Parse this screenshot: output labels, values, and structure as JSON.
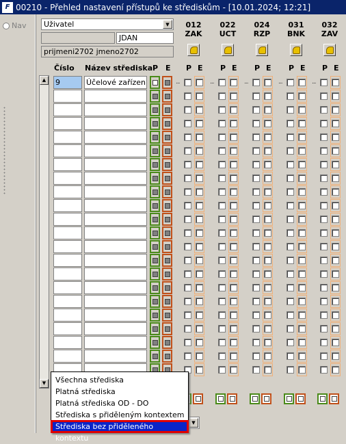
{
  "window": {
    "title": "00210 - Přehled nastavení přístupů ke střediskům - [10.01.2024; 12:21]",
    "logo": "F"
  },
  "nav": {
    "label": "Nav"
  },
  "selector": {
    "value": "Uživatel",
    "user_code": "JDAN",
    "full_name": "prijmeni2702 jmeno2702"
  },
  "columns": {
    "cislo": "Číslo",
    "nazev": "Název střediska",
    "p": "P",
    "e": "E"
  },
  "modules": [
    {
      "num": "012",
      "code": "ZAK"
    },
    {
      "num": "022",
      "code": "UCT"
    },
    {
      "num": "024",
      "code": "RZP"
    },
    {
      "num": "031",
      "code": "BNK"
    },
    {
      "num": "032",
      "code": "ZAV"
    }
  ],
  "rows": [
    {
      "cislo": "9",
      "nazev": "Účelové zařízení"
    },
    {
      "cislo": "",
      "nazev": ""
    },
    {
      "cislo": "",
      "nazev": ""
    },
    {
      "cislo": "",
      "nazev": ""
    },
    {
      "cislo": "",
      "nazev": ""
    },
    {
      "cislo": "",
      "nazev": ""
    },
    {
      "cislo": "",
      "nazev": ""
    },
    {
      "cislo": "",
      "nazev": ""
    },
    {
      "cislo": "",
      "nazev": ""
    },
    {
      "cislo": "",
      "nazev": ""
    },
    {
      "cislo": "",
      "nazev": ""
    },
    {
      "cislo": "",
      "nazev": ""
    },
    {
      "cislo": "",
      "nazev": ""
    },
    {
      "cislo": "",
      "nazev": ""
    },
    {
      "cislo": "",
      "nazev": ""
    },
    {
      "cislo": "",
      "nazev": ""
    },
    {
      "cislo": "",
      "nazev": ""
    },
    {
      "cislo": "",
      "nazev": ""
    },
    {
      "cislo": "",
      "nazev": ""
    },
    {
      "cislo": "",
      "nazev": ""
    },
    {
      "cislo": "",
      "nazev": ""
    },
    {
      "cislo": "",
      "nazev": ""
    }
  ],
  "filter_menu": {
    "items": [
      "Všechna střediska",
      "Platná střediska",
      "Platná střediska OD - DO",
      "Střediska s přiděleným kontextem",
      "Střediska bez přiděleného kontextu"
    ],
    "selected_index": 4
  },
  "colors": {
    "title_bg": "#0a246a",
    "p_border": "#4a8a1a",
    "e_border": "#c0501a",
    "highlight": "#0a24c8",
    "highlight_outline": "#e00000"
  }
}
